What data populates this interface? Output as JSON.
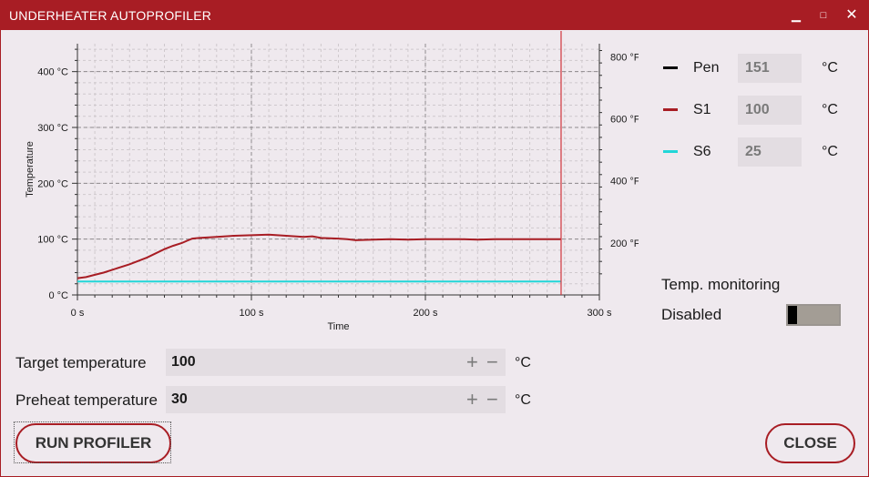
{
  "window": {
    "title": "UNDERHEATER AUTOPROFILER",
    "minimize_icon": "minimize-icon",
    "maximize_icon": "maximize-icon",
    "close_icon": "close-icon"
  },
  "chart_data": {
    "type": "line",
    "xlabel": "Time",
    "ylabel": "Temperature",
    "x_ticks": [
      "0 s",
      "100 s",
      "200 s",
      "300 s"
    ],
    "y_ticks": [
      "0 °C",
      "100 °C",
      "200 °C",
      "300 °C",
      "400 °C"
    ],
    "y2_ticks": [
      "200 °F",
      "400 °F",
      "600 °F",
      "800 °F"
    ],
    "xlim": [
      0,
      300
    ],
    "ylim": [
      0,
      450
    ],
    "y2lim": [
      32,
      842
    ],
    "grid": true,
    "cursor_x": 278,
    "series": [
      {
        "name": "S1",
        "color": "#a81d24",
        "x": [
          0,
          5,
          10,
          15,
          20,
          30,
          40,
          50,
          55,
          60,
          63,
          66,
          70,
          80,
          90,
          100,
          110,
          120,
          130,
          135,
          140,
          150,
          155,
          160,
          170,
          180,
          190,
          200,
          210,
          220,
          230,
          240,
          250,
          260,
          270,
          278
        ],
        "y": [
          30,
          32,
          36,
          40,
          45,
          55,
          67,
          82,
          88,
          93,
          97,
          101,
          102,
          104,
          106,
          107,
          108,
          106,
          104,
          105,
          102,
          101,
          100,
          98,
          99,
          100,
          99,
          100,
          100,
          100,
          99,
          100,
          100,
          100,
          100,
          100
        ]
      },
      {
        "name": "S6",
        "color": "#22d6d8",
        "x": [
          0,
          278
        ],
        "y": [
          24,
          24
        ]
      }
    ]
  },
  "legend": [
    {
      "name": "Pen",
      "value": "151",
      "unit": "°C",
      "color": "#000000"
    },
    {
      "name": "S1",
      "value": "100",
      "unit": "°C",
      "color": "#a81d24"
    },
    {
      "name": "S6",
      "value": "25",
      "unit": "°C",
      "color": "#22d6d8"
    }
  ],
  "monitoring": {
    "label": "Temp. monitoring",
    "state": "Disabled",
    "toggle_on": false
  },
  "fields": {
    "target": {
      "label": "Target temperature",
      "value": "100",
      "unit": "°C",
      "plus": "+",
      "minus": "−"
    },
    "preheat": {
      "label": "Preheat temperature",
      "value": "30",
      "unit": "°C",
      "plus": "+",
      "minus": "−"
    }
  },
  "buttons": {
    "run": "RUN PROFILER",
    "close": "CLOSE"
  }
}
